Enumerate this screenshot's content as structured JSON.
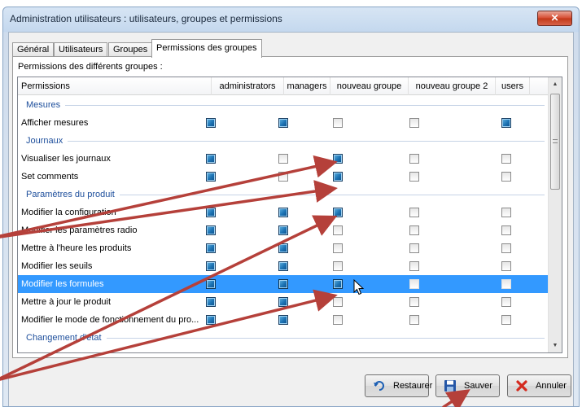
{
  "window": {
    "title": "Administration utilisateurs : utilisateurs, groupes et permissions",
    "close_label": "✕"
  },
  "tabs": [
    {
      "label": "Général",
      "active": false
    },
    {
      "label": "Utilisateurs",
      "active": false
    },
    {
      "label": "Groupes",
      "active": false
    },
    {
      "label": "Permissions des groupes",
      "active": true
    }
  ],
  "panel": {
    "label": "Permissions des différents groupes :"
  },
  "grid": {
    "columns": [
      "Permissions",
      "administrators",
      "managers",
      "nouveau groupe",
      "nouveau groupe 2",
      "users"
    ],
    "selected_row": 10,
    "rows": [
      {
        "type": "group",
        "label": "Mesures"
      },
      {
        "type": "perm",
        "label": "Afficher mesures",
        "values": [
          true,
          true,
          false,
          false,
          true
        ]
      },
      {
        "type": "group",
        "label": "Journaux"
      },
      {
        "type": "perm",
        "label": "Visualiser les journaux",
        "values": [
          true,
          false,
          true,
          false,
          false
        ]
      },
      {
        "type": "perm",
        "label": "Set comments",
        "values": [
          true,
          false,
          true,
          false,
          false
        ]
      },
      {
        "type": "group",
        "label": "Paramètres du produit"
      },
      {
        "type": "perm",
        "label": "Modifier la configuration",
        "values": [
          true,
          true,
          true,
          false,
          false
        ]
      },
      {
        "type": "perm",
        "label": "Modifier les paramètres radio",
        "values": [
          true,
          true,
          false,
          false,
          false
        ]
      },
      {
        "type": "perm",
        "label": "Mettre à l'heure les produits",
        "values": [
          true,
          true,
          false,
          false,
          false
        ]
      },
      {
        "type": "perm",
        "label": "Modifier les seuils",
        "values": [
          true,
          true,
          false,
          false,
          false
        ]
      },
      {
        "type": "perm",
        "label": "Modifier les formules",
        "values": [
          true,
          true,
          true,
          false,
          false
        ]
      },
      {
        "type": "perm",
        "label": "Mettre à jour le produit",
        "values": [
          true,
          true,
          false,
          false,
          false
        ]
      },
      {
        "type": "perm",
        "label": "Modifier le mode de fonctionnement du pro...",
        "values": [
          true,
          true,
          false,
          false,
          false
        ]
      },
      {
        "type": "group",
        "label": "Changement d'état"
      }
    ]
  },
  "buttons": {
    "restore_label": "Restaurer",
    "save_label": "Sauver",
    "cancel_label": "Annuler"
  },
  "colors": {
    "selection": "#3399ff",
    "checked": "#1b72b3",
    "annotation_arrow": "#b5403a",
    "close_button": "#c13818"
  }
}
